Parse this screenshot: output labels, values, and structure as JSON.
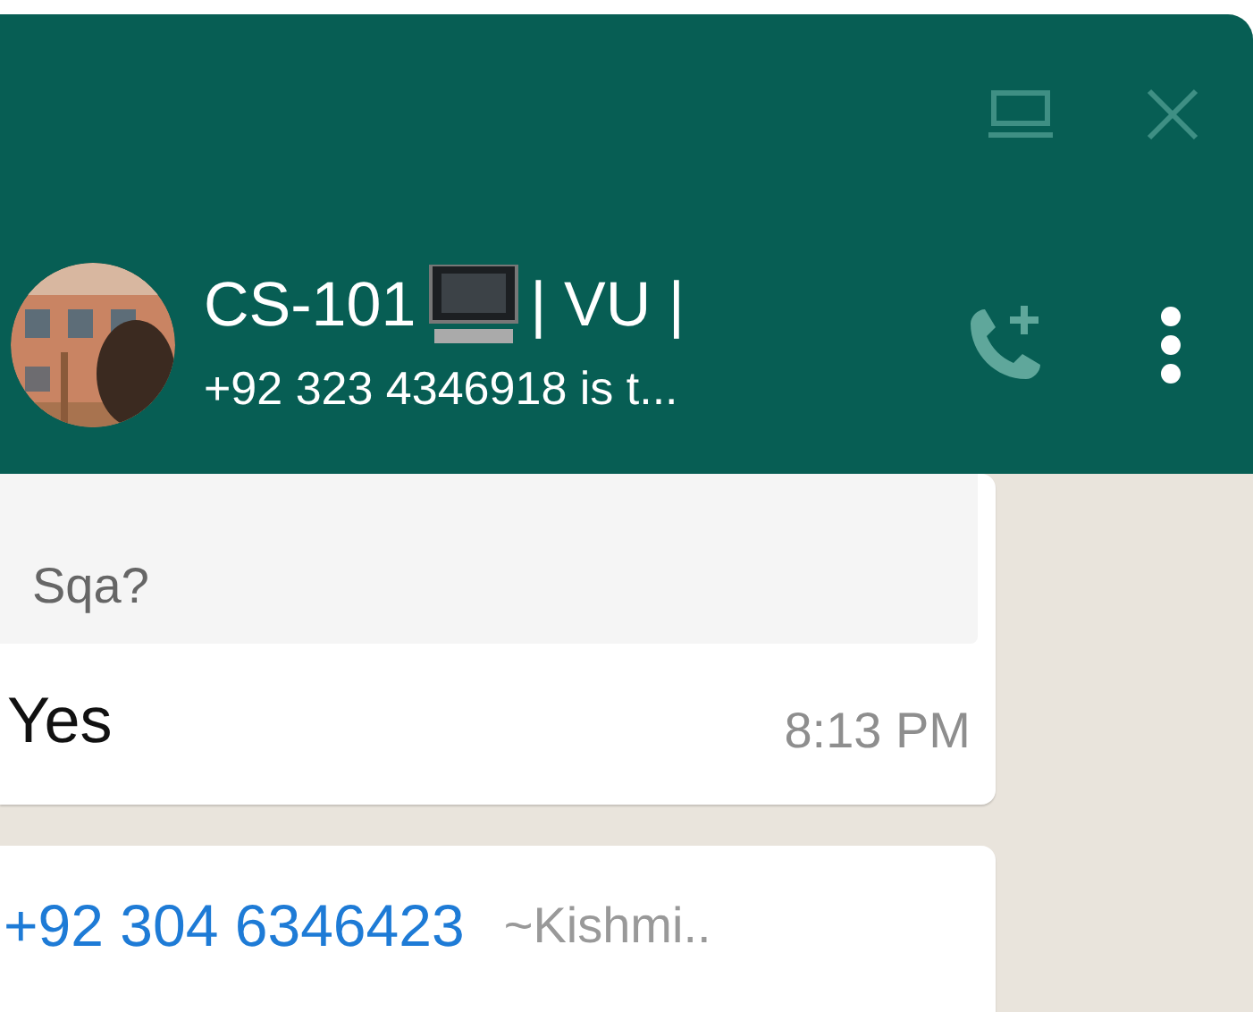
{
  "window_controls": [
    {
      "kind": "minimize"
    },
    {
      "kind": "close"
    }
  ],
  "chat_header": {
    "title_parts": [
      "CS-101",
      "| VU |"
    ],
    "subtitle": "+92 323 4346918 is t..."
  },
  "header_actions": [
    {
      "kind": "add-call"
    },
    {
      "kind": "menu"
    }
  ],
  "messages": [
    {
      "quote": {
        "text": "Sqa?"
      },
      "text": "Yes",
      "time": "8:13 PM"
    },
    {
      "sender": "+92 304 6346423",
      "sender_name": "~Kishmi.."
    }
  ]
}
